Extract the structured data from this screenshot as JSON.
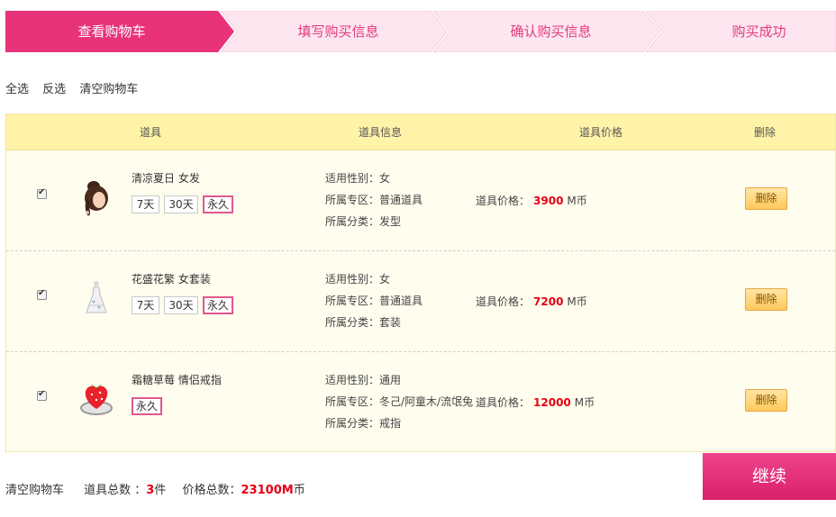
{
  "steps": [
    {
      "label": "查看购物车"
    },
    {
      "label": "填写购买信息"
    },
    {
      "label": "确认购买信息"
    },
    {
      "label": "购买成功"
    }
  ],
  "toolbar": {
    "select_all": "全选",
    "invert": "反选",
    "clear": "清空购物车"
  },
  "table_headers": {
    "item": "道具",
    "info": "道具信息",
    "price": "道具价格",
    "delete": "删除"
  },
  "items": [
    {
      "name": "清凉夏日 女发",
      "options": [
        "7天",
        "30天",
        "永久"
      ],
      "selected": "永久",
      "gender": "适用性别：女",
      "zone": "所属专区：普通道具",
      "category": "所属分类：发型",
      "price_label": "道具价格：",
      "price_value": "3900",
      "price_unit": "M币",
      "delete_label": "删除",
      "checked": true,
      "icon": "hair-icon"
    },
    {
      "name": "花盛花繁 女套装",
      "options": [
        "7天",
        "30天",
        "永久"
      ],
      "selected": "永久",
      "gender": "适用性别：女",
      "zone": "所属专区：普通道具",
      "category": "所属分类：套装",
      "price_label": "道具价格：",
      "price_value": "7200",
      "price_unit": "M币",
      "delete_label": "删除",
      "checked": true,
      "icon": "dress-icon"
    },
    {
      "name": "霜糖草莓 情侣戒指",
      "options": [
        "永久"
      ],
      "selected": "永久",
      "gender": "适用性别：通用",
      "zone": "所属专区：冬己/阿童木/流氓兔",
      "category": "所属分类：戒指",
      "price_label": "道具价格：",
      "price_value": "12000",
      "price_unit": "M币",
      "delete_label": "删除",
      "checked": true,
      "icon": "strawberry-ring-icon"
    }
  ],
  "footer": {
    "clear": "清空购物车",
    "count_label": "道具总数 ：",
    "count_value": "3",
    "count_unit": "件",
    "total_label": "价格总数：",
    "total_value": "23100M",
    "total_unit": "币",
    "continue": "继续"
  },
  "colors": {
    "accent": "#e8337b",
    "step_inactive": "#fde6ef",
    "header_bg": "#fff3a8",
    "row_bg": "#fffdee",
    "price_red": "#e60012"
  }
}
